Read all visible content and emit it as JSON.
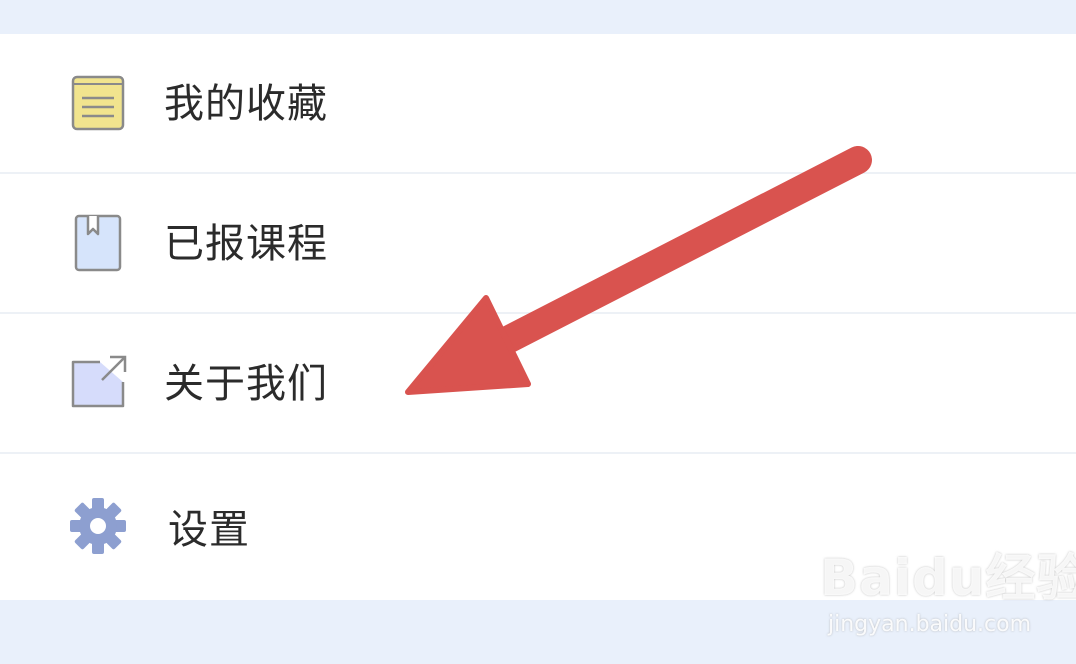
{
  "menu": {
    "items": [
      {
        "label": "我的收藏",
        "icon": "notepad-icon"
      },
      {
        "label": "已报课程",
        "icon": "bookmark-book-icon"
      },
      {
        "label": "关于我们",
        "icon": "external-link-icon"
      },
      {
        "label": "设置",
        "icon": "gear-icon"
      }
    ]
  },
  "watermark": {
    "logo": "Baidu经验",
    "url": "jingyan.baidu.com"
  },
  "colors": {
    "background": "#e9f0fb",
    "list_background": "#ffffff",
    "divider": "#edf1f6",
    "text": "#2b2b2b",
    "arrow": "#d9534f",
    "notepad_fill": "#f1e48e",
    "book_fill": "#d6e4fb",
    "link_fill": "#d6dcfb",
    "gear_fill": "#8d9fd0"
  }
}
